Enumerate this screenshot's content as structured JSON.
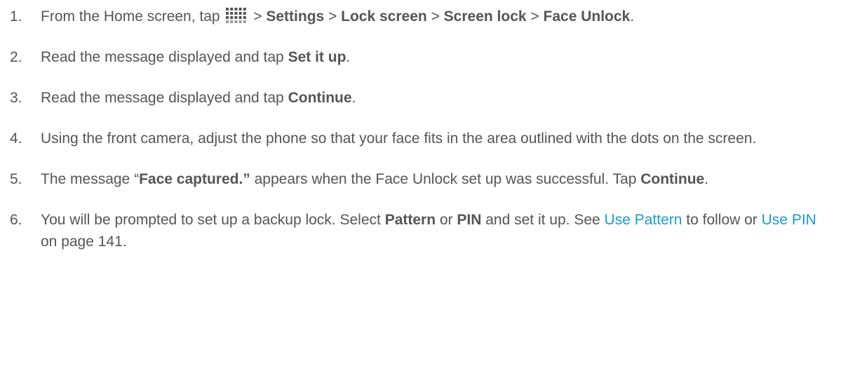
{
  "steps": [
    {
      "number": "1.",
      "parts": [
        {
          "t": "From the Home screen, tap "
        },
        {
          "icon": "apps-icon"
        },
        {
          "t": " > "
        },
        {
          "b": "Settings"
        },
        {
          "t": " > "
        },
        {
          "b": "Lock screen"
        },
        {
          "t": " > "
        },
        {
          "b": "Screen lock"
        },
        {
          "t": " > "
        },
        {
          "b": "Face Unlock"
        },
        {
          "t": "."
        }
      ]
    },
    {
      "number": "2.",
      "parts": [
        {
          "t": "Read the message displayed and tap "
        },
        {
          "b": "Set it up"
        },
        {
          "t": "."
        }
      ]
    },
    {
      "number": "3.",
      "parts": [
        {
          "t": "Read the message displayed and tap "
        },
        {
          "b": "Continue"
        },
        {
          "t": "."
        }
      ]
    },
    {
      "number": "4.",
      "parts": [
        {
          "t": "Using the front camera, adjust the phone so that your face fits in the area outlined with the dots on the screen."
        }
      ]
    },
    {
      "number": "5.",
      "parts": [
        {
          "t": "The message “"
        },
        {
          "b": "Face captured.”"
        },
        {
          "t": " appears when the Face Unlock set up was successful. Tap "
        },
        {
          "b": "Continue"
        },
        {
          "t": "."
        }
      ]
    },
    {
      "number": "6.",
      "parts": [
        {
          "t": "You will be prompted to set up a backup lock. Select "
        },
        {
          "b": "Pattern"
        },
        {
          "t": " or "
        },
        {
          "b": "PIN"
        },
        {
          "t": " and set it up. See "
        },
        {
          "link": "Use Pattern"
        },
        {
          "t": " to follow or "
        },
        {
          "link": "Use PIN"
        },
        {
          "t": " on page 141."
        }
      ]
    }
  ],
  "colors": {
    "text": "#555555",
    "link": "#1a9ac9"
  }
}
